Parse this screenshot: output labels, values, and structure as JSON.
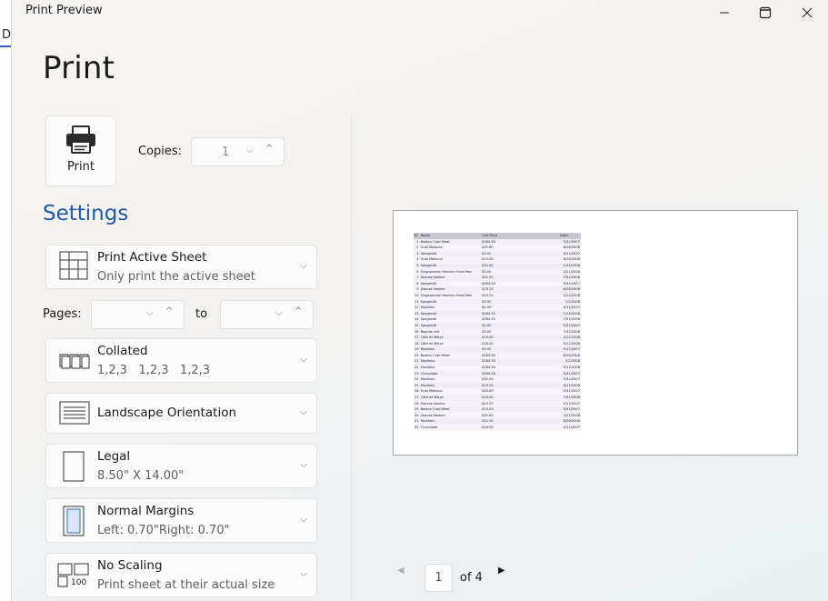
{
  "background_app": {
    "tab_fragment": "D"
  },
  "window": {
    "title": "Print Preview"
  },
  "heading": "Print",
  "print_button": {
    "label": "Print",
    "icon": "printer-icon"
  },
  "copies": {
    "label": "Copies:",
    "value": "1"
  },
  "settings_heading": "Settings",
  "settings": {
    "sheet": {
      "title": "Print Active Sheet",
      "subtitle": "Only print the active sheet"
    },
    "collation": {
      "title": "Collated",
      "subtitle": "1,2,3   1,2,3   1,2,3"
    },
    "orientation": {
      "title": "Landscape Orientation"
    },
    "paper": {
      "title": "Legal",
      "subtitle": "8.50\" X 14.00\""
    },
    "margins": {
      "title": "Normal Margins",
      "subtitle": "Left: 0.70\"Right: 0.70\""
    },
    "scaling": {
      "title": "No Scaling",
      "subtitle": "Print sheet at their actual size",
      "icon_text": "100"
    }
  },
  "pages": {
    "label": "Pages:",
    "to_label": "to",
    "from_value": "",
    "to_value": ""
  },
  "pager": {
    "current": "1",
    "total_label": "of 4"
  },
  "preview": {
    "headers": [
      "ID",
      "Name",
      "Unit Price",
      "Date"
    ],
    "rows": [
      [
        "1",
        "Boston Crab Meat",
        "$264.50",
        "5/31/2007"
      ],
      [
        "2",
        "Gula Malacca",
        "$35.60",
        "8/26/2006"
      ],
      [
        "3",
        "Spegesild",
        "$9.00",
        "4/11/2007"
      ],
      [
        "4",
        "Gula Malacca",
        "$14.00",
        "8/26/2006"
      ],
      [
        "5",
        "Spegesild",
        "$32.00",
        "1/24/2006"
      ],
      [
        "6",
        "Singaporean Hokkien Fried Mee",
        "$3.00",
        "2/22/2006"
      ],
      [
        "7",
        "Zaanse koeken",
        "$32.00",
        "7/31/2006"
      ],
      [
        "8",
        "Spegesild",
        "$264.50",
        "5/31/2007"
      ],
      [
        "9",
        "Zaanse koeken",
        "$23.25",
        "8/26/2006"
      ],
      [
        "10",
        "Singaporean Hokkien Fried Mee",
        "$23.25",
        "2/22/2006"
      ],
      [
        "11",
        "Spegesild",
        "$3.00",
        "1/2/2008"
      ],
      [
        "12",
        "Maxilaku",
        "$4.00",
        "4/11/2007"
      ],
      [
        "13",
        "Spegesild",
        "$264.50",
        "1/24/2006"
      ],
      [
        "14",
        "Spegesild",
        "$264.50",
        "7/31/2006"
      ],
      [
        "15",
        "Spegesild",
        "$3.00",
        "5/31/2007"
      ],
      [
        "16",
        "Rogede sild",
        "$3.00",
        "7/31/2006"
      ],
      [
        "17",
        "Côte de Blaye",
        "$19.00",
        "2/22/2006"
      ],
      [
        "18",
        "Côte de Blaye",
        "$18.00",
        "5/12/2006"
      ],
      [
        "19",
        "Maxilaku",
        "$9.00",
        "5/12/2007"
      ],
      [
        "20",
        "Boston Crab Meat",
        "$264.50",
        "8/26/2006"
      ],
      [
        "21",
        "Maxilaku",
        "$264.50",
        "1/2/2008"
      ],
      [
        "22",
        "Maxilaku",
        "$264.50",
        "5/12/2006"
      ],
      [
        "23",
        "Chocolade",
        "$264.50",
        "5/31/2007"
      ],
      [
        "24",
        "Maxilaku",
        "$32.00",
        "5/31/2007"
      ],
      [
        "25",
        "Maxilaku",
        "$19.00",
        "4/11/2006"
      ],
      [
        "26",
        "Gula Malacca",
        "$35.60",
        "5/31/2007"
      ],
      [
        "27",
        "Côte de Blaye",
        "$18.00",
        "7/31/2006"
      ],
      [
        "28",
        "Zaanse koeken",
        "$23.25",
        "5/12/2007"
      ],
      [
        "29",
        "Boston Crab Meat",
        "$14.00",
        "5/31/2007"
      ],
      [
        "30",
        "Zaanse koeken",
        "$35.60",
        "2/22/2006"
      ],
      [
        "31",
        "Maxilaku",
        "$32.00",
        "8/26/2006"
      ],
      [
        "32",
        "Chocolade",
        "$18.00",
        "4/11/2007"
      ]
    ]
  }
}
